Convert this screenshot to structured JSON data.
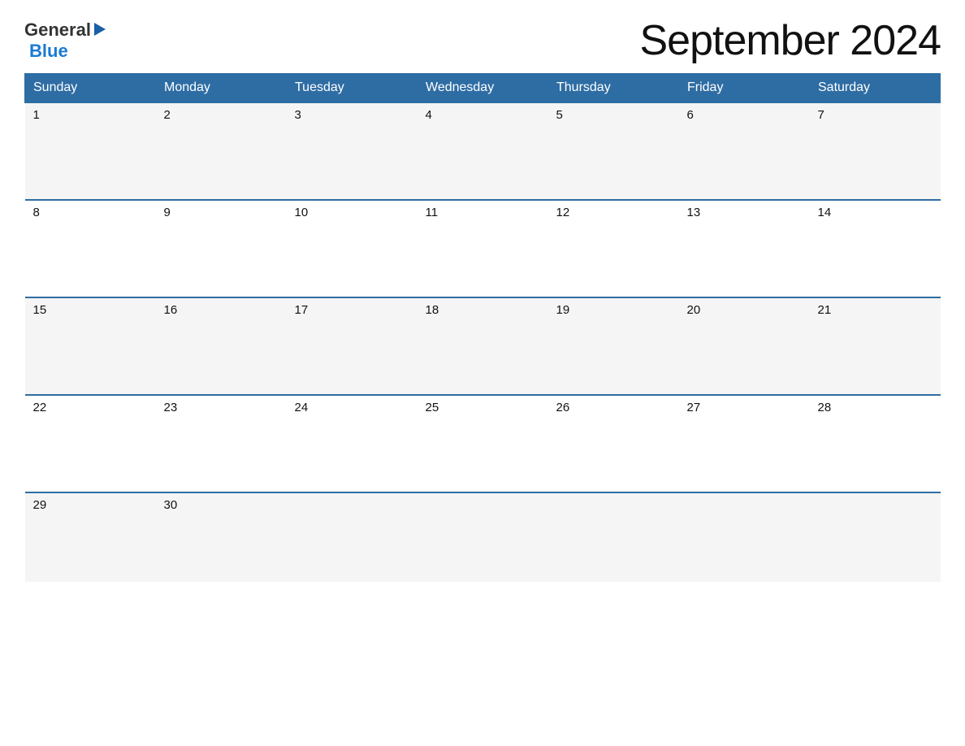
{
  "header": {
    "logo": {
      "general_text": "General",
      "blue_text": "Blue"
    },
    "title": "September 2024"
  },
  "calendar": {
    "days_of_week": [
      "Sunday",
      "Monday",
      "Tuesday",
      "Wednesday",
      "Thursday",
      "Friday",
      "Saturday"
    ],
    "weeks": [
      [
        {
          "day": "1",
          "empty": false
        },
        {
          "day": "2",
          "empty": false
        },
        {
          "day": "3",
          "empty": false
        },
        {
          "day": "4",
          "empty": false
        },
        {
          "day": "5",
          "empty": false
        },
        {
          "day": "6",
          "empty": false
        },
        {
          "day": "7",
          "empty": false
        }
      ],
      [
        {
          "day": "8",
          "empty": false
        },
        {
          "day": "9",
          "empty": false
        },
        {
          "day": "10",
          "empty": false
        },
        {
          "day": "11",
          "empty": false
        },
        {
          "day": "12",
          "empty": false
        },
        {
          "day": "13",
          "empty": false
        },
        {
          "day": "14",
          "empty": false
        }
      ],
      [
        {
          "day": "15",
          "empty": false
        },
        {
          "day": "16",
          "empty": false
        },
        {
          "day": "17",
          "empty": false
        },
        {
          "day": "18",
          "empty": false
        },
        {
          "day": "19",
          "empty": false
        },
        {
          "day": "20",
          "empty": false
        },
        {
          "day": "21",
          "empty": false
        }
      ],
      [
        {
          "day": "22",
          "empty": false
        },
        {
          "day": "23",
          "empty": false
        },
        {
          "day": "24",
          "empty": false
        },
        {
          "day": "25",
          "empty": false
        },
        {
          "day": "26",
          "empty": false
        },
        {
          "day": "27",
          "empty": false
        },
        {
          "day": "28",
          "empty": false
        }
      ],
      [
        {
          "day": "29",
          "empty": false
        },
        {
          "day": "30",
          "empty": false
        },
        {
          "day": "",
          "empty": true
        },
        {
          "day": "",
          "empty": true
        },
        {
          "day": "",
          "empty": true
        },
        {
          "day": "",
          "empty": true
        },
        {
          "day": "",
          "empty": true
        }
      ]
    ]
  }
}
